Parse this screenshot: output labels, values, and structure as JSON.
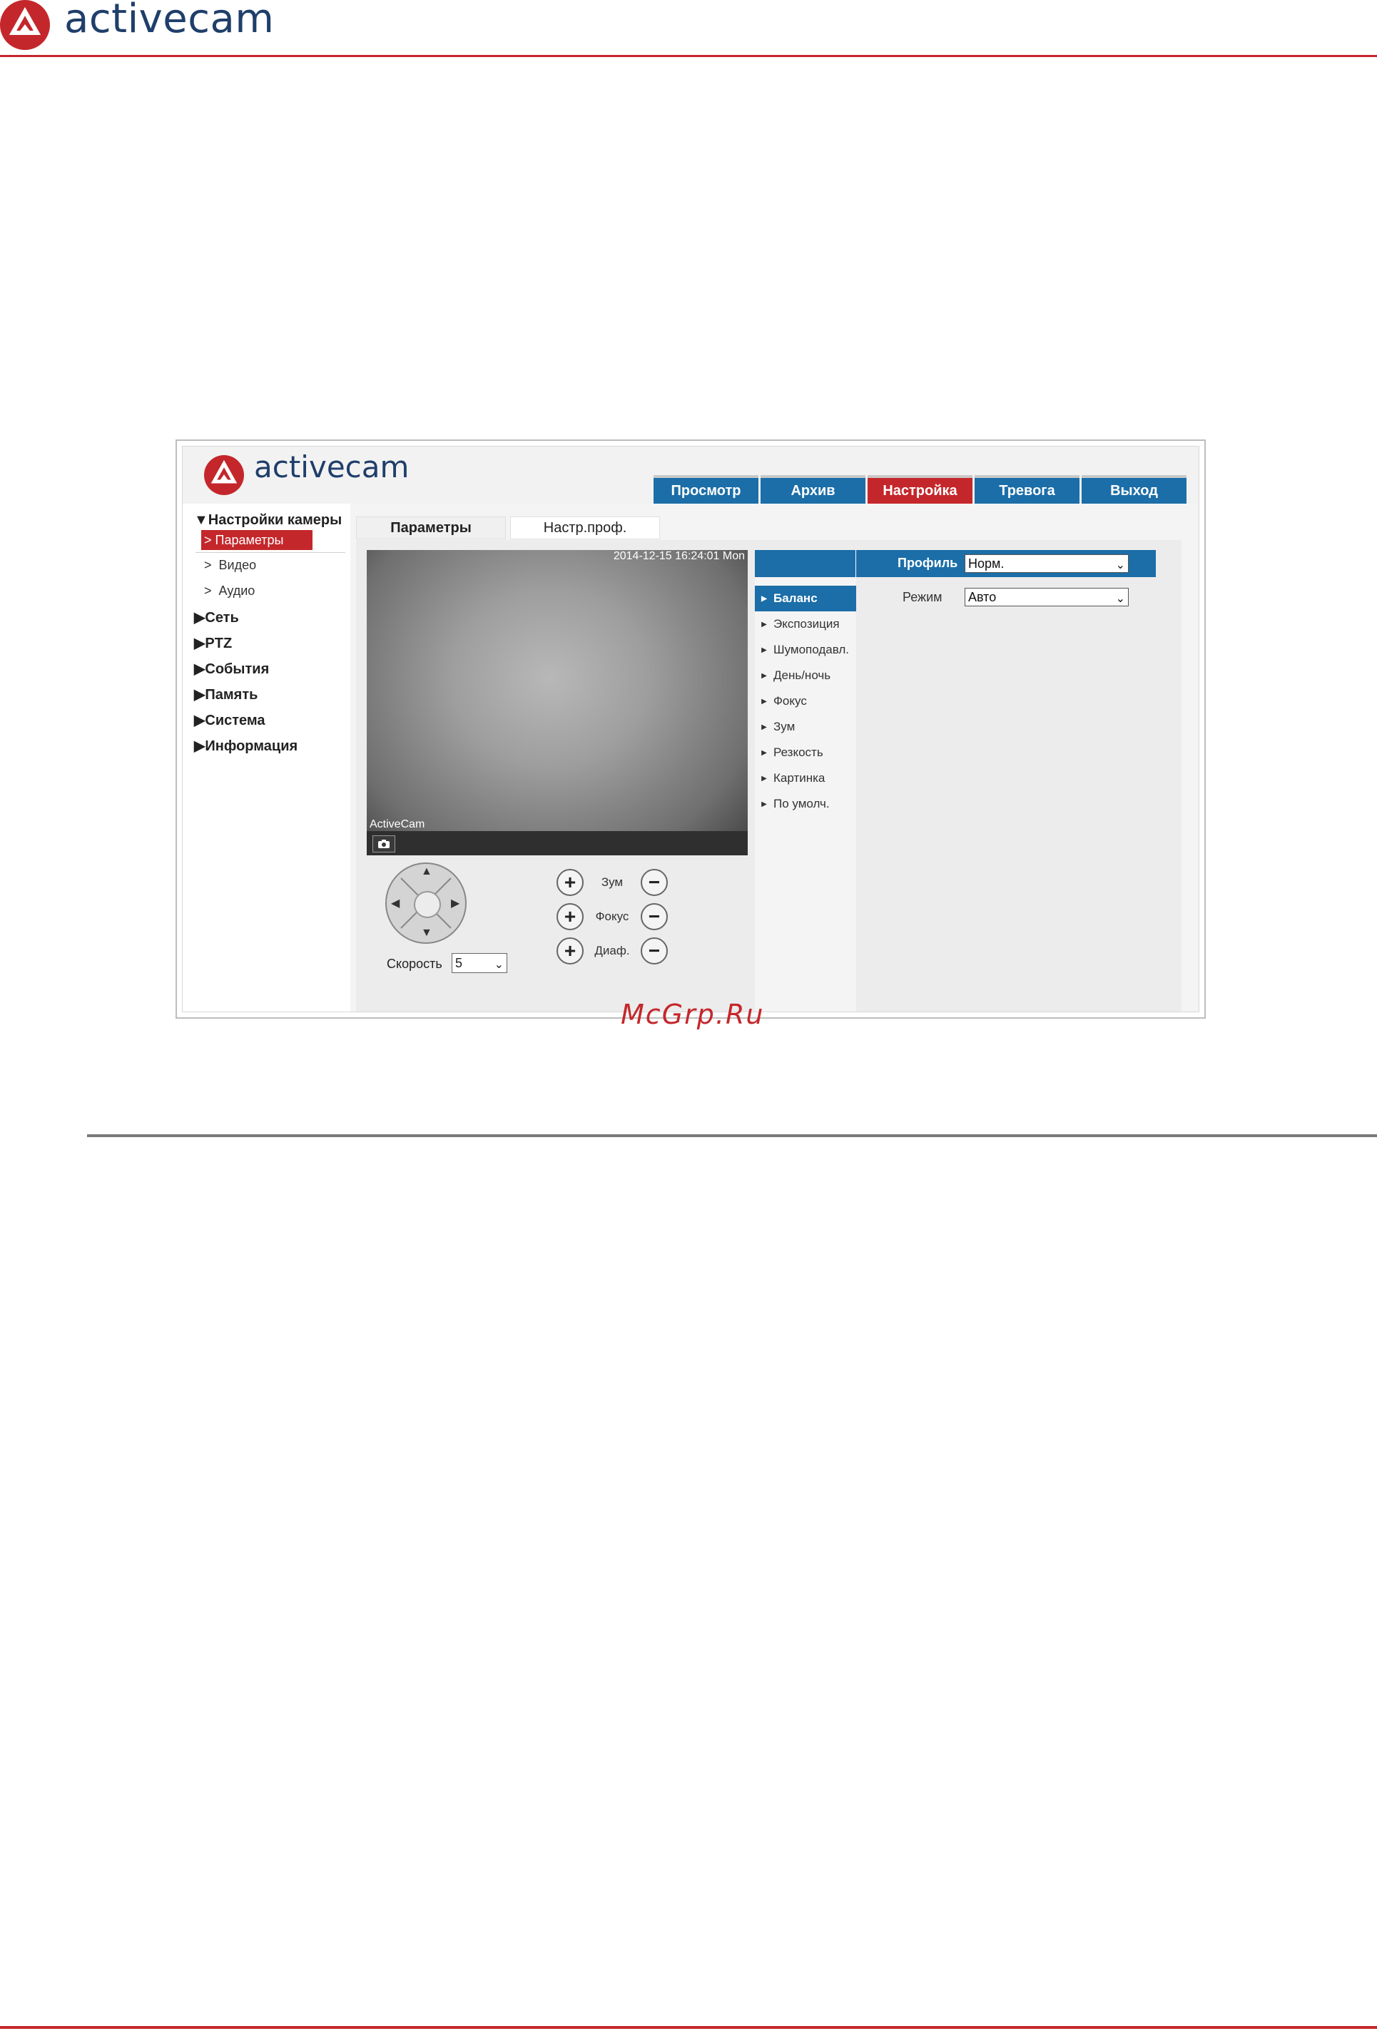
{
  "page": {
    "brand": "activecam",
    "watermark": "McGrp.Ru"
  },
  "app": {
    "brand": "activecam",
    "nav": [
      "Просмотр",
      "Архив",
      "Настройка",
      "Тревога",
      "Выход"
    ],
    "active_nav": "Настройка",
    "sidebar": {
      "camera_settings": "▼Настройки камеры",
      "sub_items": [
        "Параметры",
        "Видео",
        "Аудио"
      ],
      "sections": [
        "▶Сеть",
        "▶PTZ",
        "▶События",
        "▶Память",
        "▶Система",
        "▶Информация"
      ]
    },
    "subtabs": [
      "Параметры",
      "Настр.проф."
    ],
    "video": {
      "osd_time": "2014-12-15 16:24:01 Mon",
      "osd_name": "ActiveCam"
    },
    "ptz": {
      "speed_label": "Скорость",
      "speed_value": "5",
      "controls": [
        "Зум",
        "Фокус",
        "Диаф."
      ]
    },
    "profile": {
      "label": "Профиль",
      "value": "Норм."
    },
    "menu": [
      "Баланс",
      "Экспозиция",
      "Шумоподавл.",
      "День/ночь",
      "Фокус",
      "Зум",
      "Резкость",
      "Картинка",
      "По умолч."
    ],
    "mode": {
      "label": "Режим",
      "value": "Авто"
    }
  }
}
